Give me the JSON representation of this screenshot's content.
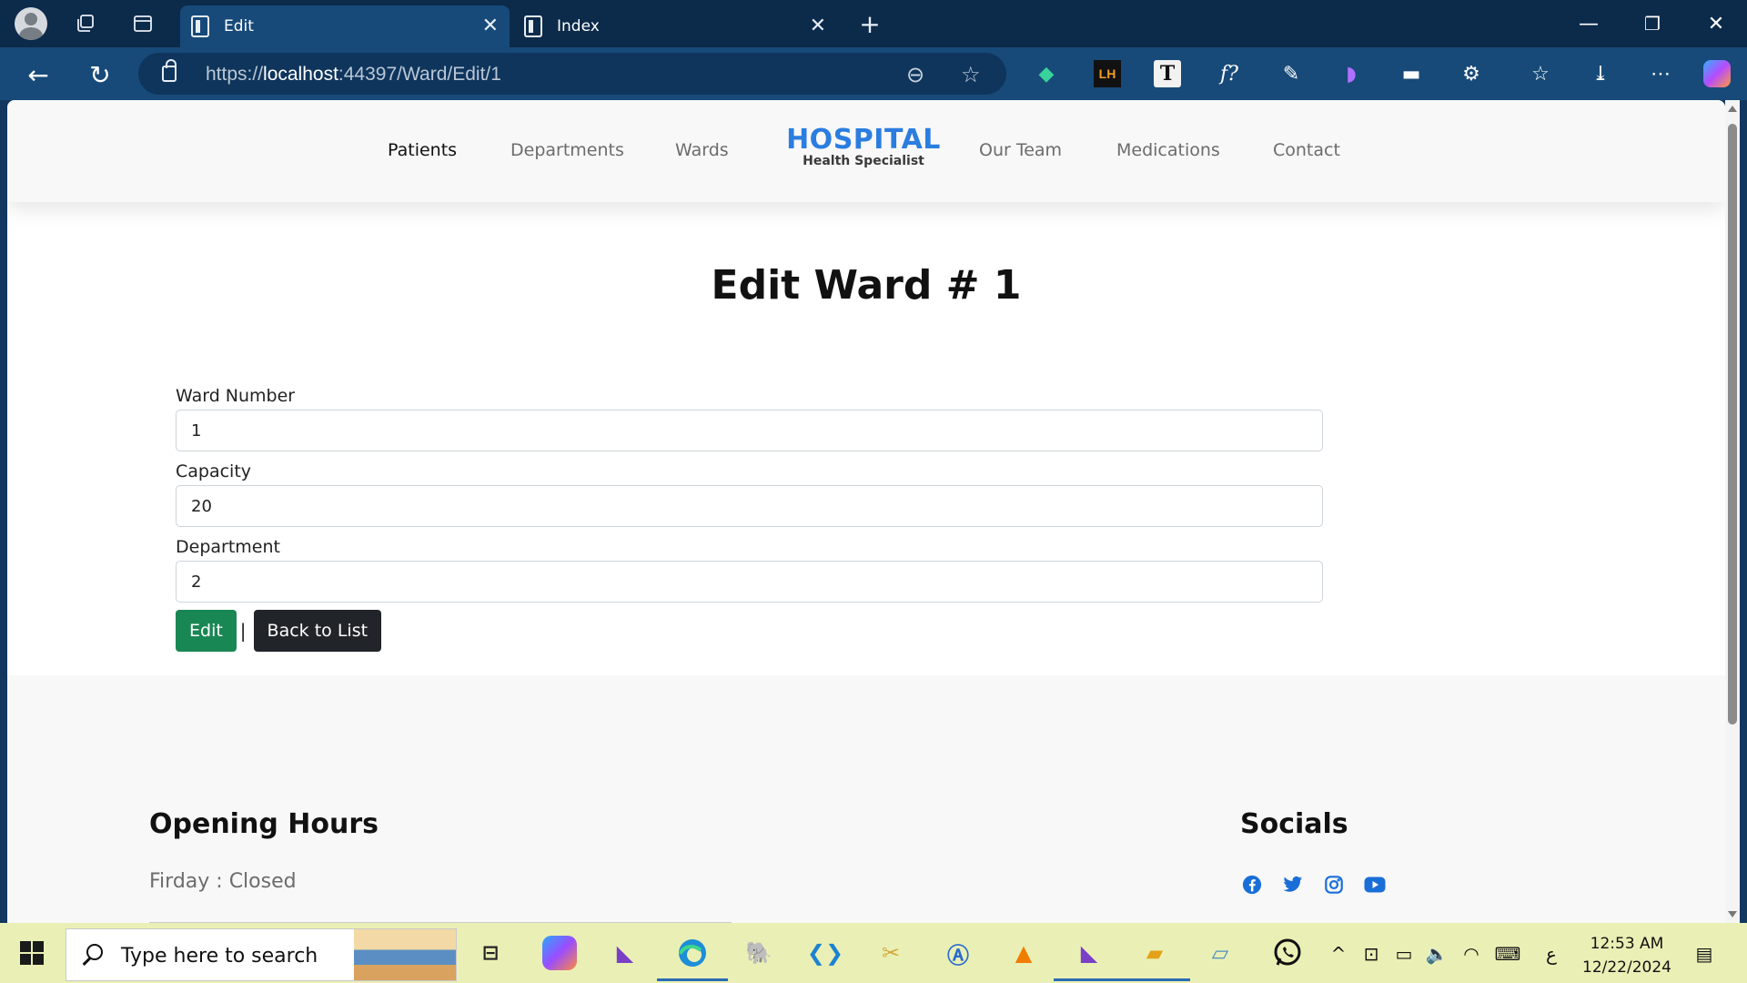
{
  "browser": {
    "tabs": [
      {
        "title": "Edit",
        "active": true
      },
      {
        "title": "Index",
        "active": false
      }
    ],
    "url": {
      "scheme": "https://",
      "host": "localhost",
      "path": ":44397/Ward/Edit/1"
    }
  },
  "nav": {
    "left_links": [
      "Patients",
      "Departments",
      "Wards"
    ],
    "brand_title": "HOSPITAL",
    "brand_subtitle": "Health Specialist",
    "right_links": [
      "Our Team",
      "Medications",
      "Contact"
    ],
    "active_link": "Patients"
  },
  "page": {
    "title": "Edit Ward # 1"
  },
  "form": {
    "fields": [
      {
        "label": "Ward Number",
        "value": "1"
      },
      {
        "label": "Capacity",
        "value": "20"
      },
      {
        "label": "Department",
        "value": "2"
      }
    ],
    "edit_label": "Edit",
    "separator": "|",
    "back_label": "Back to List"
  },
  "footer": {
    "hours_title": "Opening Hours",
    "hours_item": "Firday : Closed",
    "socials_title": "Socials",
    "socials": [
      "facebook-icon",
      "twitter-icon",
      "instagram-icon",
      "youtube-icon"
    ]
  },
  "taskbar": {
    "search_placeholder": "Type here to search",
    "time": "12:53 AM",
    "date": "12/22/2024",
    "lang": "ع"
  },
  "colors": {
    "brand": "#2b7de0",
    "edit_button": "#198754",
    "back_button": "#212529",
    "social": "#1a6ed8"
  }
}
